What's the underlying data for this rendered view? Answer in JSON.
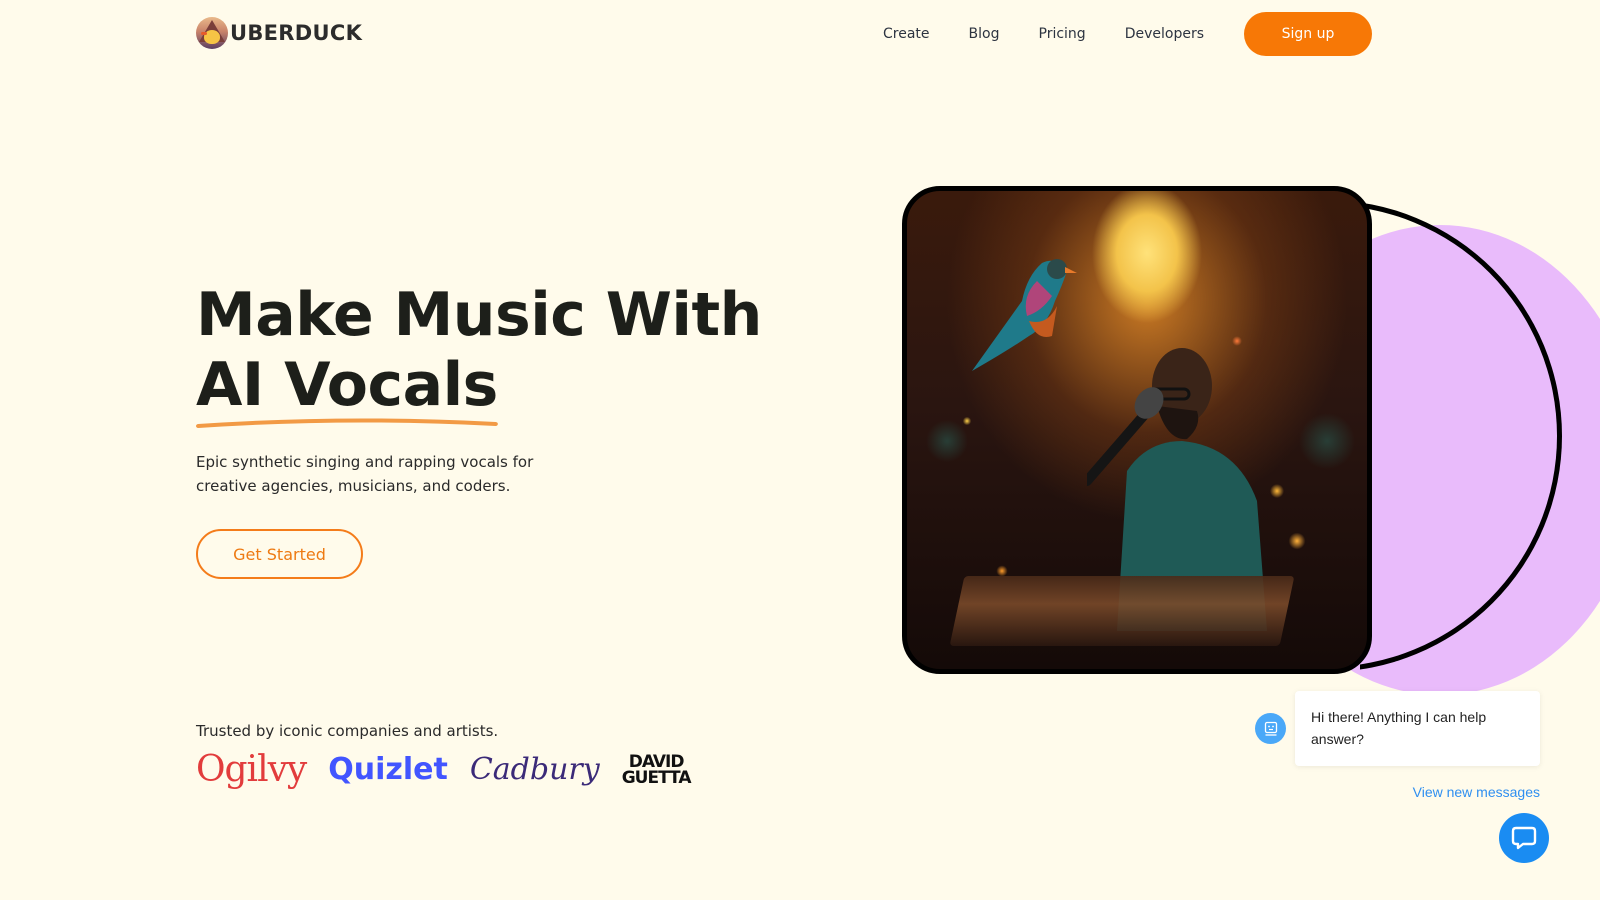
{
  "brand": {
    "name": "UBERDUCK",
    "logo_icon": "duck-logo-icon"
  },
  "nav": {
    "links": [
      "Create",
      "Blog",
      "Pricing",
      "Developers"
    ],
    "signup_label": "Sign up"
  },
  "hero": {
    "title_line1": "Make Music With",
    "title_line2": "AI Vocals",
    "subtitle": "Epic synthetic singing and rapping vocals for creative agencies, musicians, and coders.",
    "cta_label": "Get Started",
    "image_alt": "Man singing into microphone at piano with a colorful bird perched nearby"
  },
  "trusted": {
    "label": "Trusted by iconic companies and artists.",
    "brands": [
      "Ogilvy",
      "Quizlet",
      "Cadbury",
      "DAVID",
      "GUETTA"
    ]
  },
  "chat": {
    "message": "Hi there! Anything I can help answer?",
    "view_messages": "View new messages",
    "avatar_icon": "bot-face-icon",
    "launcher_icon": "chat-bubble-icon"
  },
  "colors": {
    "background": "#fffbeb",
    "accent": "#f77806",
    "purple": "#e9bbfb",
    "chat_blue": "#1a8cf2",
    "ogilvy_red": "#e23c3c",
    "quizlet_blue": "#4255ff",
    "cadbury_purple": "#3b2a78"
  }
}
